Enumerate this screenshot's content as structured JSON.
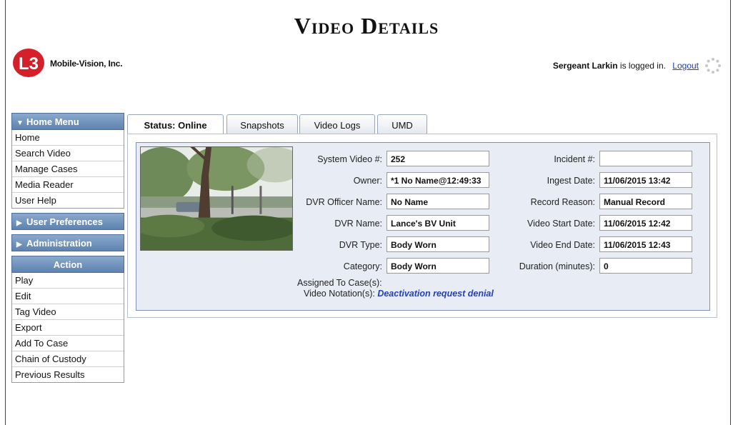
{
  "header": {
    "title": "Video Details",
    "company": "Mobile-Vision, Inc.",
    "user_name": "Sergeant Larkin",
    "logged_in_text": "is logged in.",
    "logout_label": "Logout"
  },
  "sidebar": {
    "home_menu": {
      "title": "Home Menu",
      "items": [
        "Home",
        "Search Video",
        "Manage Cases",
        "Media Reader",
        "User Help"
      ]
    },
    "user_preferences": "User Preferences",
    "administration": "Administration",
    "action": {
      "title": "Action",
      "items": [
        "Play",
        "Edit",
        "Tag Video",
        "Export",
        "Add To Case",
        "Chain of Custody",
        "Previous Results"
      ]
    }
  },
  "tabs": [
    "Status: Online",
    "Snapshots",
    "Video Logs",
    "UMD"
  ],
  "details": {
    "left": [
      {
        "label": "System Video #:",
        "value": "252"
      },
      {
        "label": "Owner:",
        "value": "*1 No Name@12:49:33"
      },
      {
        "label": "DVR Officer Name:",
        "value": "No Name"
      },
      {
        "label": "DVR Name:",
        "value": "Lance's BV Unit"
      },
      {
        "label": "DVR Type:",
        "value": "Body Worn"
      },
      {
        "label": "Category:",
        "value": "Body Worn"
      }
    ],
    "right": [
      {
        "label": "Incident #:",
        "value": ""
      },
      {
        "label": "Ingest Date:",
        "value": "11/06/2015 13:42"
      },
      {
        "label": "Record Reason:",
        "value": "Manual Record"
      },
      {
        "label": "Video Start Date:",
        "value": "11/06/2015 12:42"
      },
      {
        "label": "Video End Date:",
        "value": "11/06/2015 12:43"
      },
      {
        "label": "Duration (minutes):",
        "value": "0"
      }
    ],
    "assigned_label": "Assigned To Case(s):",
    "notation_label": "Video Notation(s):",
    "notation_value": "Deactivation request denial"
  },
  "colors": {
    "menu_header": "#5e83b0",
    "panel_bg": "#e7ecf5",
    "link": "#1a3fb0",
    "logo_red": "#d4202a"
  }
}
